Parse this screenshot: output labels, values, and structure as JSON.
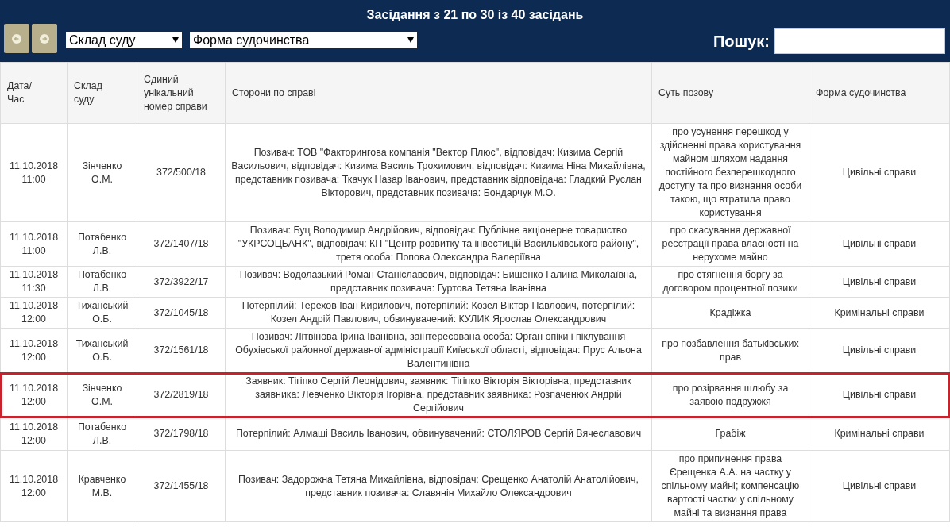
{
  "header": {
    "title": "Засідання з 21 по 30 із 40 засідань",
    "filters": [
      {
        "label": "Склад суду"
      },
      {
        "label": "Форма судочинства"
      }
    ],
    "search": {
      "label": "Пошук:"
    }
  },
  "table": {
    "columns": [
      "Дата/ Час",
      "Склад суду",
      "Єдиний унікальний номер справи",
      "Сторони по справі",
      "Суть позову",
      "Форма судочинства"
    ],
    "rows": [
      {
        "selected": false,
        "cells": [
          "11.10.2018 11:00",
          "Зінченко О.М.",
          "372/500/18",
          "Позивач: ТОВ \"Факторингова компанія \"Вектор Плюс\", відповідач: Кизима Сергій Васильович, відповідач: Кизима Василь Трохимович, відповідач: Кизима Ніна Михайлівна, представник позивача: Ткачук Назар Іванович, представник відповідача: Гладкий Руслан Вікторович, представник позивача: Бондарчук М.О.",
          "про усунення перешкод у здійсненні права користування майном шляхом надання постійного безперешкодного доступу та про визнання особи такою, що втратила право користування",
          "Цивільні справи"
        ]
      },
      {
        "selected": false,
        "cells": [
          "11.10.2018 11:00",
          "Потабенко Л.В.",
          "372/1407/18",
          "Позивач: Буц Володимир Андрійович, відповідач: Публічне акціонерне товариство \"УКРСОЦБАНК\", відповідач: КП \"Центр розвитку та інвестицій Васильківського району\", третя особа: Попова Олександра Валеріївна",
          "про скасування державної реєстрації права власності на нерухоме майно",
          "Цивільні справи"
        ]
      },
      {
        "selected": false,
        "cells": [
          "11.10.2018 11:30",
          "Потабенко Л.В.",
          "372/3922/17",
          "Позивач: Водолазький Роман Станіславович, відповідач: Бишенко Галина Миколаївна, представник позивача: Гуртова Тетяна Іванівна",
          "про стягнення боргу за договором процентної позики",
          "Цивільні справи"
        ]
      },
      {
        "selected": false,
        "cells": [
          "11.10.2018 12:00",
          "Тиханський О.Б.",
          "372/1045/18",
          "Потерпілий: Терехов Іван Кирилович, потерпілий: Козел Віктор Павлович, потерпілий: Козел Андрій Павлович, обвинувачений: КУЛИК Ярослав Олександрович",
          "Крадіжка",
          "Кримінальні справи"
        ]
      },
      {
        "selected": false,
        "cells": [
          "11.10.2018 12:00",
          "Тиханський О.Б.",
          "372/1561/18",
          "Позивач: Літвінова Ірина Іванівна, заінтересована особа: Орган опіки і піклування Обухівської районної державної адміністрації Київської області, відповідач: Прус Альона Валентинівна",
          "про позбавлення батьківських прав",
          "Цивільні справи"
        ]
      },
      {
        "selected": true,
        "cells": [
          "11.10.2018 12:00",
          "Зінченко О.М.",
          "372/2819/18",
          "Заявник: Тігіпко Сергій Леонідович, заявник: Тігіпко Вікторія Вікторівна, представник заявника: Левченко Вікторія Ігорівна, представник заявника: Розпаченюк Андрій Сергійович",
          "про розірвання шлюбу за заявою подружжя",
          "Цивільні справи"
        ]
      },
      {
        "selected": false,
        "cells": [
          "11.10.2018 12:00",
          "Потабенко Л.В.",
          "372/1798/18",
          "Потерпілий: Алмаші Василь Іванович, обвинувачений: СТОЛЯРОВ Сергій Вячеславович",
          "Грабіж",
          "Кримінальні справи"
        ]
      },
      {
        "selected": false,
        "cells": [
          "11.10.2018 12:00",
          "Кравченко М.В.",
          "372/1455/18",
          "Позивач: Задорожна Тетяна Михайлівна, відповідач: Єрещенко Анатолій Анатолійович, представник позивача: Славянін Михайло Олександрович",
          "про припинення права Єрещенка А.А. на частку у спільному майні; компенсацію вартості частки у спільному майні та визнання права",
          "Цивільні справи"
        ]
      }
    ]
  }
}
